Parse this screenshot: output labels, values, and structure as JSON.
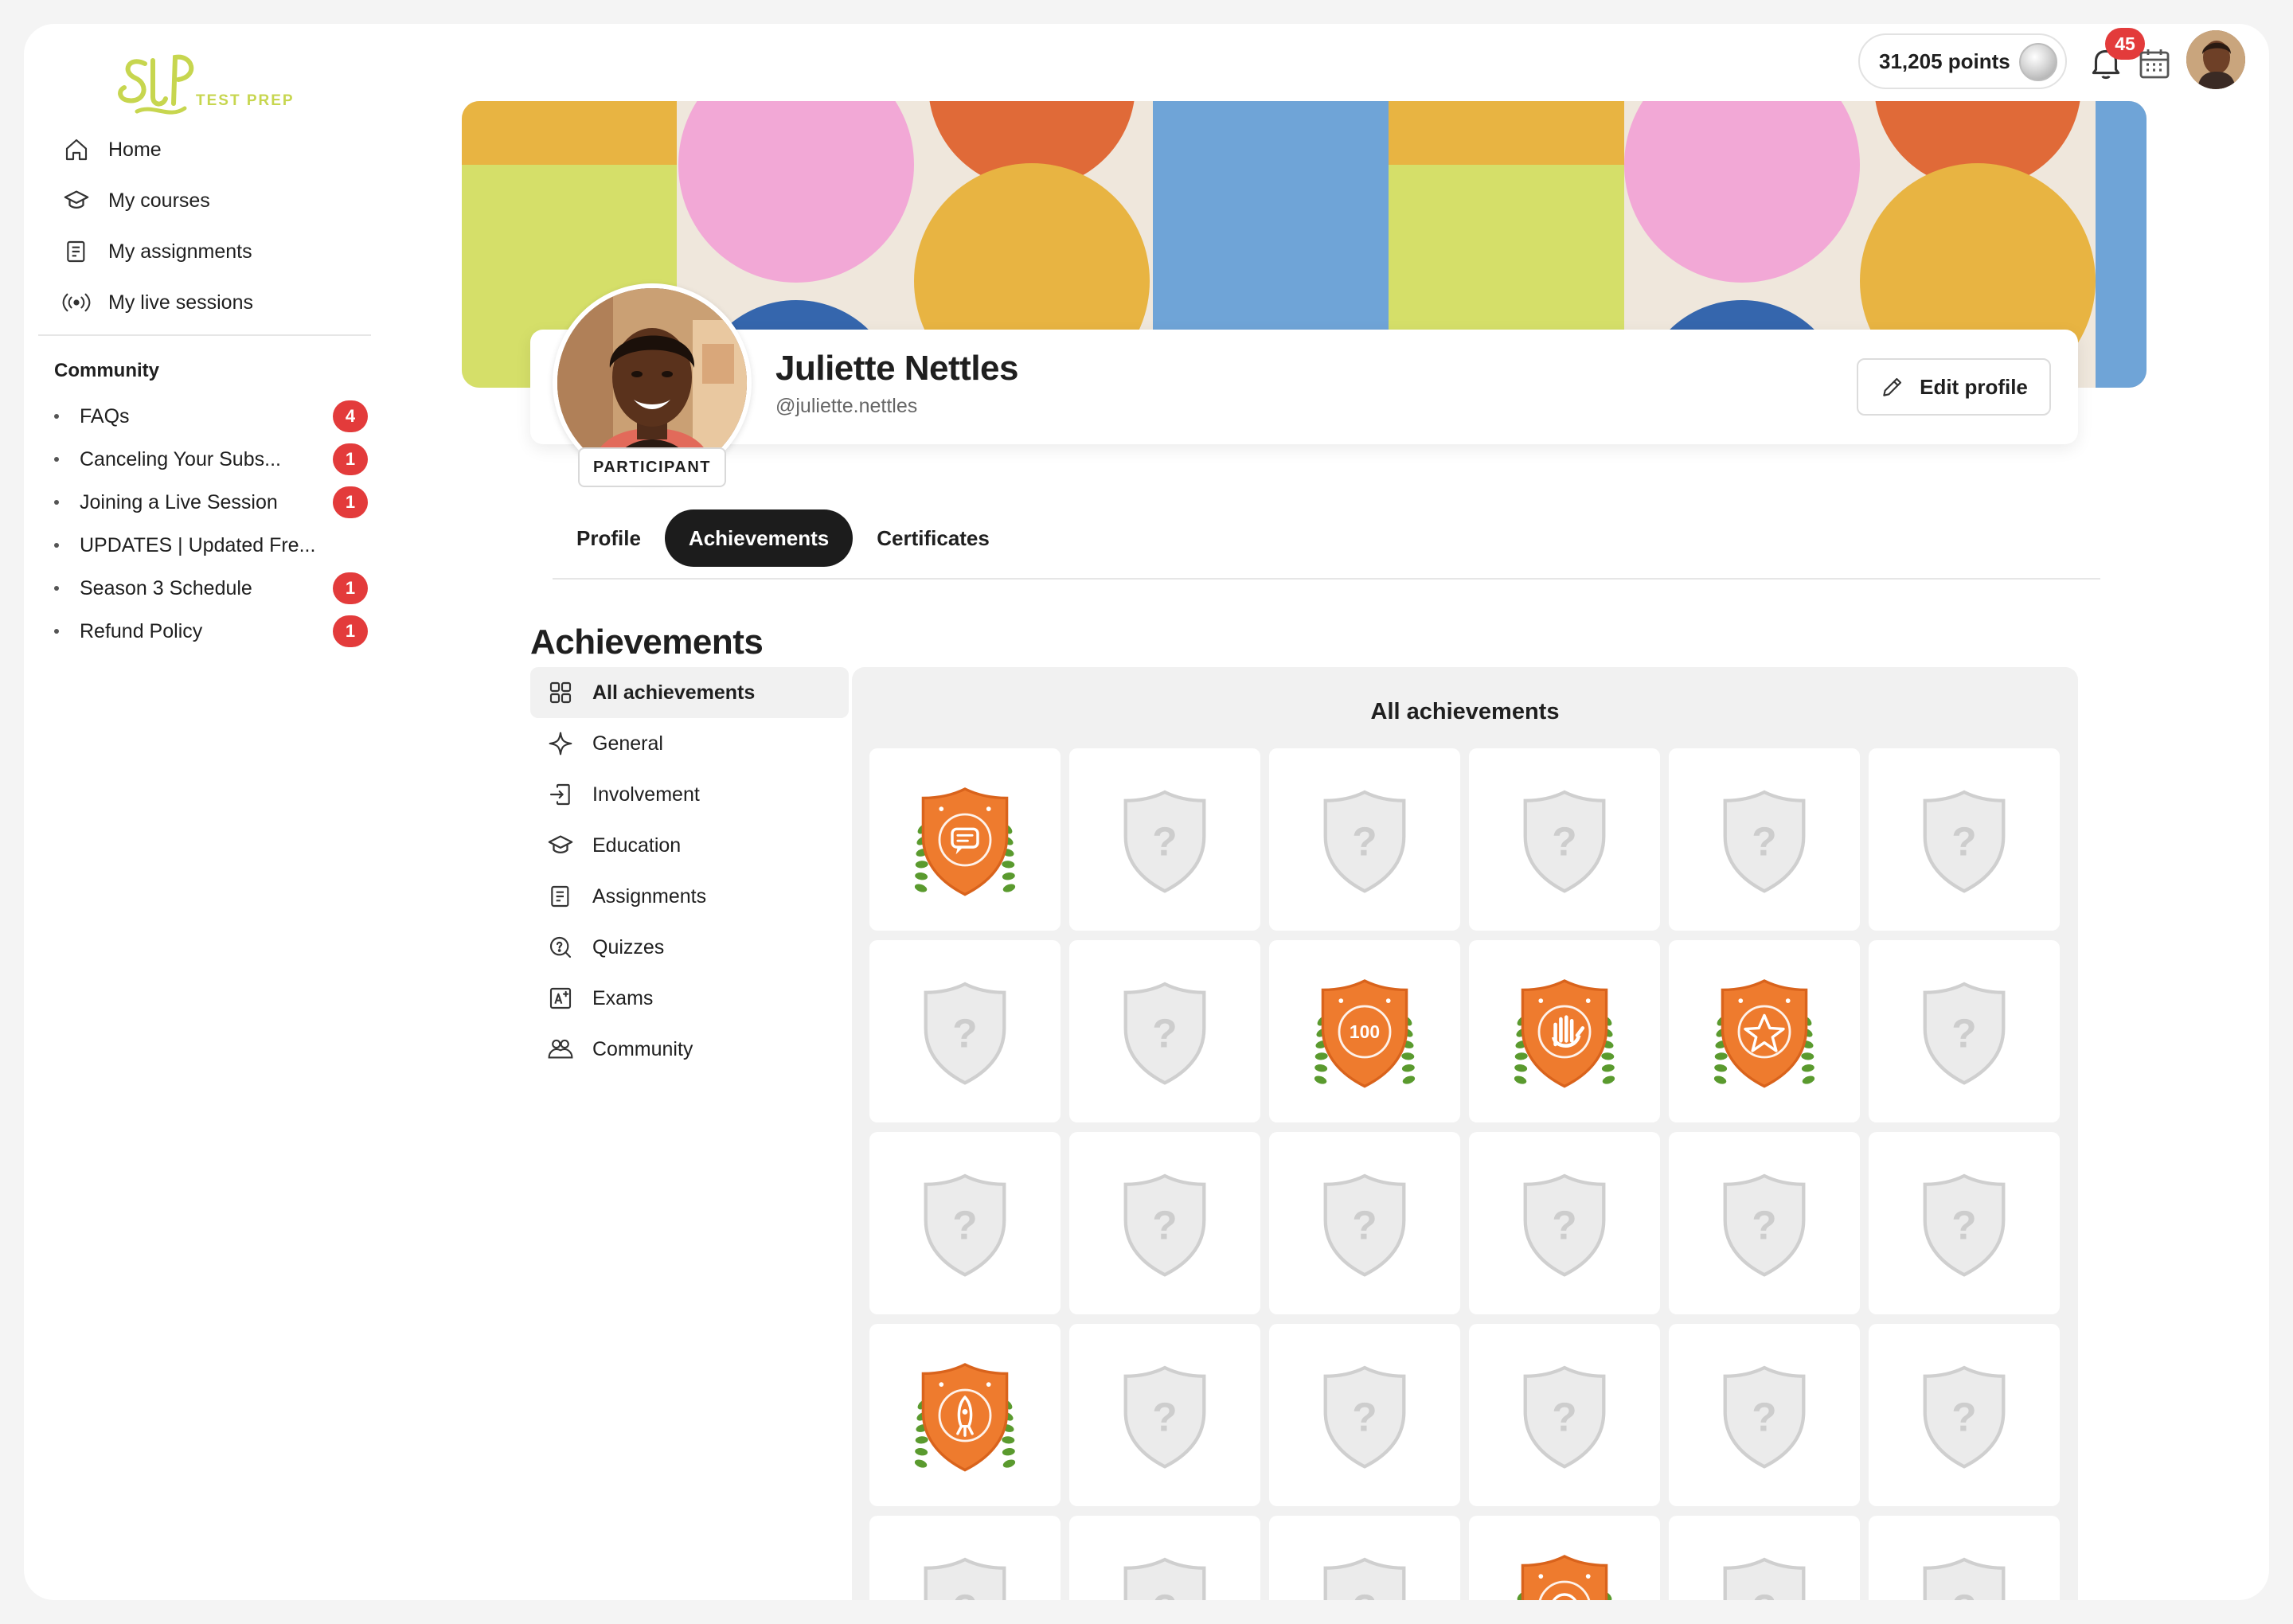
{
  "brand": {
    "logo_text": "TEST PREP",
    "accent": "#c7d64f"
  },
  "nav": [
    {
      "label": "Home",
      "icon": "home-icon"
    },
    {
      "label": "My courses",
      "icon": "graduation-cap-icon"
    },
    {
      "label": "My assignments",
      "icon": "assignment-icon"
    },
    {
      "label": "My live sessions",
      "icon": "broadcast-icon"
    }
  ],
  "community": {
    "title": "Community",
    "items": [
      {
        "label": "FAQs",
        "count": "4"
      },
      {
        "label": "Canceling Your Subs...",
        "count": "1"
      },
      {
        "label": "Joining a Live Session",
        "count": "1"
      },
      {
        "label": "UPDATES | Updated Fre...",
        "count": ""
      },
      {
        "label": "Season 3 Schedule",
        "count": "1"
      },
      {
        "label": "Refund Policy",
        "count": "1"
      }
    ]
  },
  "topbar": {
    "points": "31,205 points",
    "notifications": "45"
  },
  "profile": {
    "name": "Juliette Nettles",
    "handle": "@juliette.nettles",
    "role": "PARTICIPANT",
    "edit_label": "Edit profile"
  },
  "tabs": [
    {
      "label": "Profile",
      "active": false
    },
    {
      "label": "Achievements",
      "active": true
    },
    {
      "label": "Certificates",
      "active": false
    }
  ],
  "section_title": "Achievements",
  "categories": [
    {
      "label": "All achievements",
      "icon": "grid-icon",
      "active": true
    },
    {
      "label": "General",
      "icon": "sparkle-icon",
      "active": false
    },
    {
      "label": "Involvement",
      "icon": "login-icon",
      "active": false
    },
    {
      "label": "Education",
      "icon": "graduation-cap-icon",
      "active": false
    },
    {
      "label": "Assignments",
      "icon": "assignment-icon",
      "active": false
    },
    {
      "label": "Quizzes",
      "icon": "quiz-icon",
      "active": false
    },
    {
      "label": "Exams",
      "icon": "exam-icon",
      "active": false
    },
    {
      "label": "Community",
      "icon": "community-icon",
      "active": false
    }
  ],
  "grid": {
    "title": "All achievements",
    "badges": [
      "chat",
      "locked",
      "locked",
      "locked",
      "locked",
      "locked",
      "locked",
      "locked",
      "hundred",
      "hand",
      "star",
      "locked",
      "locked",
      "locked",
      "locked",
      "locked",
      "locked",
      "locked",
      "rocket",
      "locked",
      "locked",
      "locked",
      "locked",
      "locked",
      "locked",
      "locked",
      "locked",
      "target",
      "locked",
      "locked"
    ]
  },
  "colors": {
    "badge_orange": "#ee7b2e",
    "locked": "#e7e7e7",
    "alert": "#e33b3b",
    "leaf": "#5a9a2e"
  }
}
